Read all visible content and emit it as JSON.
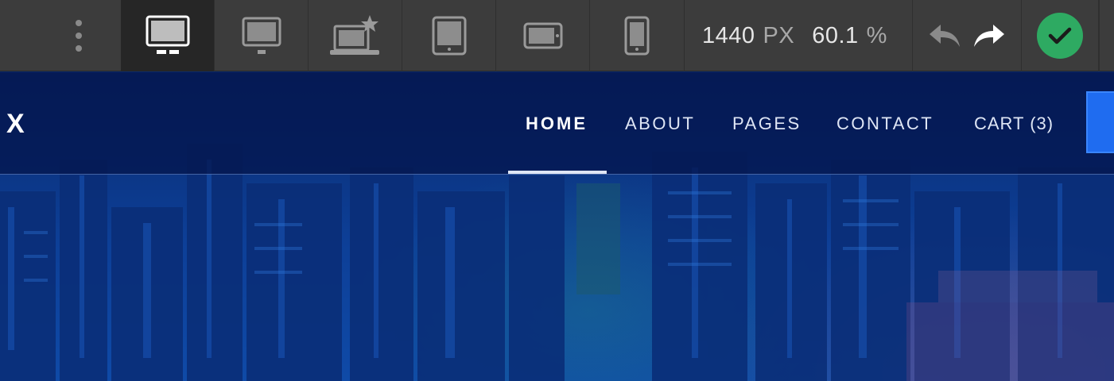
{
  "toolbar": {
    "width_value": "1440",
    "width_unit": "PX",
    "zoom_value": "60.1",
    "zoom_unit": "%",
    "devices": [
      "desktop-icon",
      "monitor-icon",
      "laptop-star-icon",
      "tablet-portrait-icon",
      "tablet-landscape-icon",
      "phone-icon"
    ],
    "active_device": "desktop-icon",
    "confirm_color": "#2eaa62"
  },
  "site": {
    "logo": "X",
    "nav": {
      "home": "HOME",
      "about": "ABOUT",
      "pages": "PAGES",
      "contact": "CONTACT",
      "cart": "CART (3)"
    },
    "active_nav": "HOME",
    "accent_color": "#1f6cf0"
  }
}
